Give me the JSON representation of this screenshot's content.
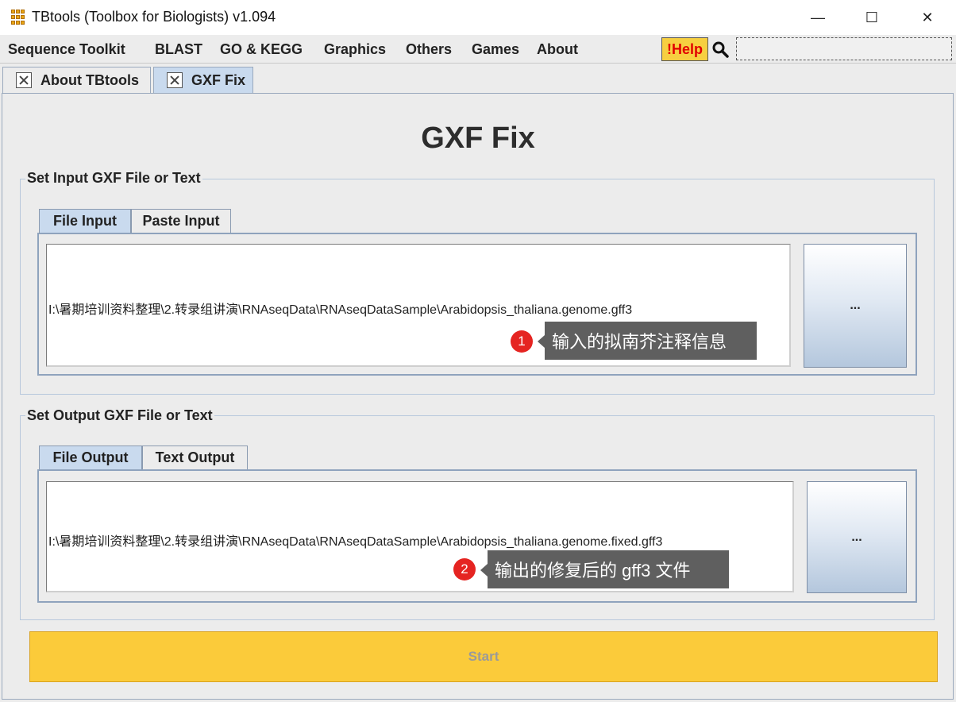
{
  "window": {
    "title": "TBtools (Toolbox for Biologists) v1.094",
    "minimize": "—",
    "maximize": "☐",
    "close": "✕"
  },
  "menu": {
    "items": [
      "Sequence Toolkit",
      "BLAST",
      "GO & KEGG",
      "Graphics",
      "Others",
      "Games",
      "About"
    ],
    "help_label": "!Help",
    "search_value": ""
  },
  "doc_tabs": [
    {
      "label": "About TBtools",
      "selected": false
    },
    {
      "label": "GXF Fix",
      "selected": true
    }
  ],
  "page": {
    "title": "GXF Fix"
  },
  "input_group": {
    "title": "Set Input GXF File or Text",
    "tabs": [
      "File Input",
      "Paste Input"
    ],
    "path": "I:\\暑期培训资料整理\\2.转录组讲演\\RNAseqData\\RNAseqDataSample\\Arabidopsis_thaliana.genome.gff3",
    "browse_label": "...",
    "callout_number": "1",
    "callout_text": "输入的拟南芥注释信息"
  },
  "output_group": {
    "title": "Set Output GXF File or Text",
    "tabs": [
      "File Output",
      "Text Output"
    ],
    "path": "I:\\暑期培训资料整理\\2.转录组讲演\\RNAseqData\\RNAseqDataSample\\Arabidopsis_thaliana.genome.fixed.gff3",
    "browse_label": "...",
    "callout_number": "2",
    "callout_text": "输出的修复后的 gff3 文件"
  },
  "start_label": "Start",
  "colors": {
    "accent_tab": "#c9daee",
    "start_button": "#fbcb3a",
    "help_button": "#f7cf40",
    "callout_badge": "#e52421"
  }
}
